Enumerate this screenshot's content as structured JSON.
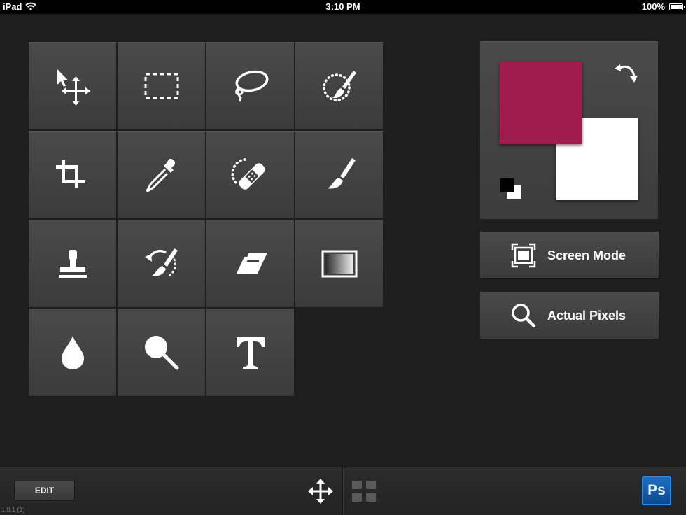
{
  "status_bar": {
    "device": "iPad",
    "time": "3:10 PM",
    "battery": "100%"
  },
  "tools": [
    {
      "name": "move-tool",
      "icon": "move-arrow-icon"
    },
    {
      "name": "marquee-tool",
      "icon": "rectangular-marquee-icon"
    },
    {
      "name": "lasso-tool",
      "icon": "lasso-icon"
    },
    {
      "name": "quick-selection-tool",
      "icon": "quick-selection-brush-icon"
    },
    {
      "name": "crop-tool",
      "icon": "crop-icon"
    },
    {
      "name": "eyedropper-tool",
      "icon": "eyedropper-icon"
    },
    {
      "name": "healing-tool",
      "icon": "bandage-icon"
    },
    {
      "name": "brush-tool",
      "icon": "paint-brush-icon"
    },
    {
      "name": "clone-stamp-tool",
      "icon": "stamp-icon"
    },
    {
      "name": "history-brush-tool",
      "icon": "history-brush-icon"
    },
    {
      "name": "eraser-tool",
      "icon": "eraser-icon"
    },
    {
      "name": "gradient-tool",
      "icon": "gradient-icon"
    },
    {
      "name": "blur-tool",
      "icon": "water-drop-icon"
    },
    {
      "name": "zoom-tool",
      "icon": "magnifier-icon"
    },
    {
      "name": "type-tool",
      "icon": "text-t-icon"
    }
  ],
  "colors": {
    "foreground": "#9e1c4e",
    "background": "#ffffff"
  },
  "buttons": {
    "screen_mode": "Screen Mode",
    "actual_pixels": "Actual Pixels"
  },
  "bottom_bar": {
    "edit_label": "EDIT",
    "version": "1.0.1 (1)",
    "app_logo": "Ps"
  }
}
